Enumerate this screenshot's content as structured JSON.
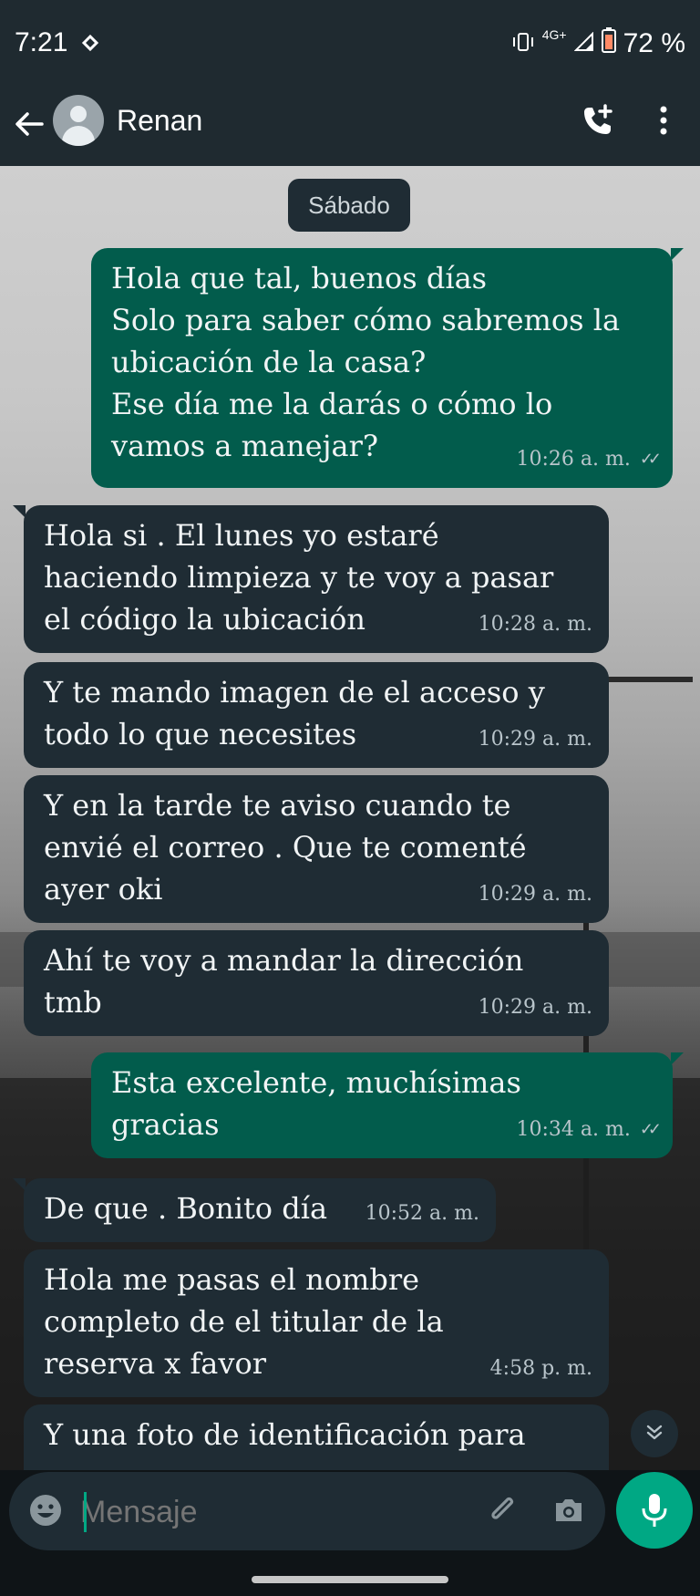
{
  "status_bar": {
    "time": "7:21",
    "network": "4G+",
    "battery": "72 %"
  },
  "header": {
    "contact_name": "Renan"
  },
  "chat": {
    "date_chip": "Sábado",
    "messages": [
      {
        "dir": "out",
        "text": "Hola que tal, buenos días\nSolo para saber cómo sabremos la\nubicación de la casa?\nEse día me la darás o cómo lo\nvamos a manejar?",
        "time": "10:26 a. m.",
        "status": "read"
      },
      {
        "dir": "in",
        "text": "Hola si . El lunes yo estaré\nhaciendo limpieza y te voy a pasar\nel código la ubicación",
        "time": "10:28 a. m."
      },
      {
        "dir": "in",
        "text": "Y te mando imagen de el acceso y\ntodo lo que necesites",
        "time": "10:29 a. m."
      },
      {
        "dir": "in",
        "text": "Y en la tarde te aviso cuando te\nenvié el correo . Que te comenté\nayer oki",
        "time": "10:29 a. m."
      },
      {
        "dir": "in",
        "text": "Ahí te voy a mandar la dirección\ntmb",
        "time": "10:29 a. m."
      },
      {
        "dir": "out",
        "text": "Esta excelente, muchísimas\ngracias",
        "time": "10:34 a. m.",
        "status": "read"
      },
      {
        "dir": "in",
        "text": "De que . Bonito día",
        "time": "10:52 a. m."
      },
      {
        "dir": "in",
        "text": "Hola me pasas el nombre\ncompleto de el titular de la\nreserva x favor",
        "time": "4:58 p. m."
      },
      {
        "dir": "in",
        "text": "Y una foto de identificación para",
        "time": ""
      }
    ]
  },
  "composer": {
    "placeholder": "Mensaje"
  },
  "colors": {
    "header_bg": "#1f2a30",
    "outgoing_bubble": "#025c4c",
    "incoming_bubble": "#1f2c34",
    "accent": "#00a884"
  },
  "icons": [
    "back-arrow-icon",
    "avatar-icon",
    "add-call-icon",
    "more-vert-icon",
    "double-check-icon",
    "scroll-down-icon",
    "emoji-icon",
    "attach-icon",
    "camera-icon",
    "mic-icon"
  ]
}
